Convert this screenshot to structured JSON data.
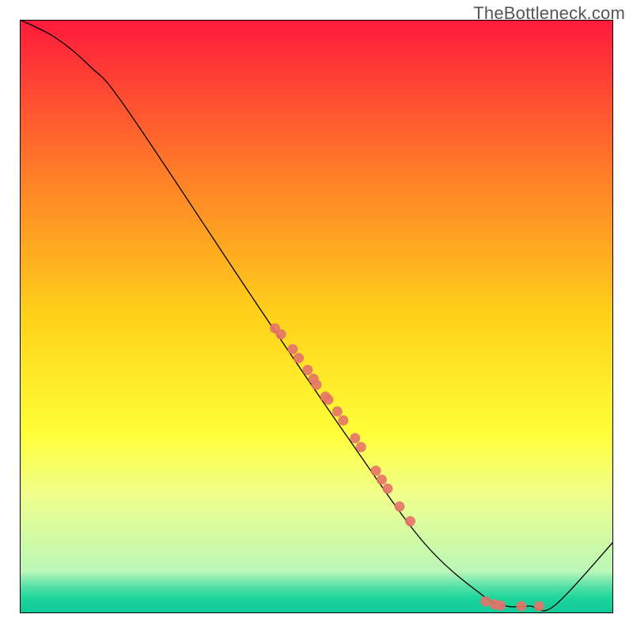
{
  "watermark": "TheBottleneck.com",
  "chart_data": {
    "type": "line",
    "title": "",
    "xlabel": "",
    "ylabel": "",
    "xlim": [
      0,
      100
    ],
    "ylim": [
      0,
      100
    ],
    "grid": false,
    "legend": false,
    "background_gradient": {
      "stops": [
        {
          "offset": 0.0,
          "color": "#ff1a3c"
        },
        {
          "offset": 0.25,
          "color": "#ff7a28"
        },
        {
          "offset": 0.5,
          "color": "#ffd21a"
        },
        {
          "offset": 0.7,
          "color": "#ffff3a"
        },
        {
          "offset": 0.8,
          "color": "#f0ff8c"
        },
        {
          "offset": 0.93,
          "color": "#baf7b8"
        },
        {
          "offset": 0.955,
          "color": "#55e0a8"
        },
        {
          "offset": 0.975,
          "color": "#1cd59b"
        },
        {
          "offset": 1.0,
          "color": "#10c99a"
        }
      ]
    },
    "series": [
      {
        "name": "bottleneck-curve",
        "type": "line",
        "points": [
          {
            "x": 0.0,
            "y": 100.0
          },
          {
            "x": 6.0,
            "y": 97.0
          },
          {
            "x": 12.0,
            "y": 92.0
          },
          {
            "x": 18.0,
            "y": 85.0
          },
          {
            "x": 40.0,
            "y": 52.0
          },
          {
            "x": 55.0,
            "y": 30.0
          },
          {
            "x": 68.0,
            "y": 12.0
          },
          {
            "x": 78.0,
            "y": 3.0
          },
          {
            "x": 82.0,
            "y": 1.2
          },
          {
            "x": 86.0,
            "y": 1.2
          },
          {
            "x": 90.0,
            "y": 1.2
          },
          {
            "x": 100.0,
            "y": 12.0
          }
        ]
      },
      {
        "name": "data-points",
        "type": "scatter",
        "points": [
          {
            "x": 43.0,
            "y": 48.0
          },
          {
            "x": 44.0,
            "y": 47.0
          },
          {
            "x": 46.0,
            "y": 44.5
          },
          {
            "x": 47.0,
            "y": 43.0
          },
          {
            "x": 48.5,
            "y": 41.0
          },
          {
            "x": 49.5,
            "y": 39.5
          },
          {
            "x": 50.0,
            "y": 38.5
          },
          {
            "x": 51.5,
            "y": 36.5
          },
          {
            "x": 52.0,
            "y": 36.0
          },
          {
            "x": 53.5,
            "y": 34.0
          },
          {
            "x": 54.5,
            "y": 32.5
          },
          {
            "x": 56.5,
            "y": 29.5
          },
          {
            "x": 57.5,
            "y": 28.0
          },
          {
            "x": 60.0,
            "y": 24.0
          },
          {
            "x": 61.0,
            "y": 22.5
          },
          {
            "x": 62.0,
            "y": 21.0
          },
          {
            "x": 64.0,
            "y": 18.0
          },
          {
            "x": 65.8,
            "y": 15.5
          },
          {
            "x": 78.5,
            "y": 2.0
          },
          {
            "x": 80.0,
            "y": 1.5
          },
          {
            "x": 81.0,
            "y": 1.3
          },
          {
            "x": 84.5,
            "y": 1.2
          },
          {
            "x": 87.5,
            "y": 1.2
          }
        ]
      }
    ]
  }
}
